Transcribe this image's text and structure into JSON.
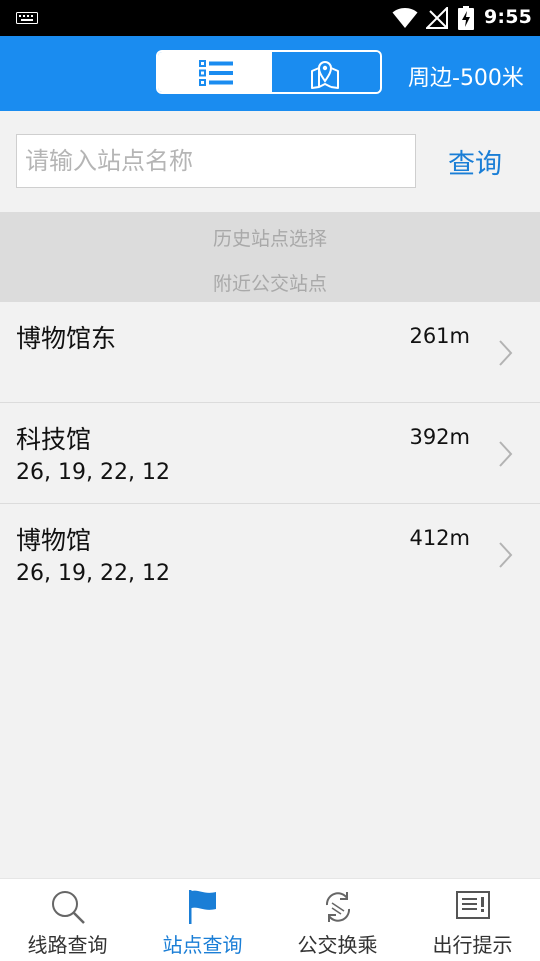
{
  "status_bar": {
    "time": "9:55"
  },
  "header": {
    "view_toggle": {
      "list_icon": "list-icon",
      "map_icon": "map-pin-icon",
      "selected": "list"
    },
    "radius_label": "周边-500米"
  },
  "search": {
    "placeholder": "请输入站点名称",
    "value": "",
    "button_label": "查询"
  },
  "section": {
    "history_label": "历史站点选择",
    "nearby_label": "附近公交站点"
  },
  "stations": [
    {
      "name": "博物馆东",
      "lines": "",
      "distance": "261m"
    },
    {
      "name": "科技馆",
      "lines": "26, 19, 22, 12",
      "distance": "392m"
    },
    {
      "name": "博物馆",
      "lines": "26, 19, 22, 12",
      "distance": "412m"
    }
  ],
  "bottom_nav": {
    "items": [
      {
        "label": "线路查询",
        "icon": "search-icon"
      },
      {
        "label": "站点查询",
        "icon": "flag-icon"
      },
      {
        "label": "公交换乘",
        "icon": "transfer-icon"
      },
      {
        "label": "出行提示",
        "icon": "notice-icon"
      }
    ],
    "active_index": 1
  },
  "colors": {
    "accent": "#1a8cf0",
    "link": "#1a7ed6",
    "section_bg": "#dcdcdc",
    "page_bg": "#f2f2f2"
  }
}
